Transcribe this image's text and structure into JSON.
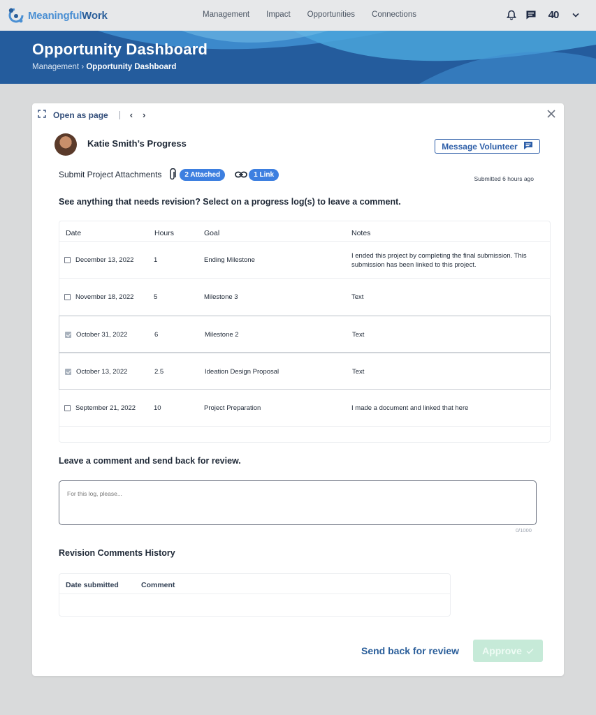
{
  "nav": {
    "logo_part1": "Meaningful",
    "logo_part2": "Work",
    "links": [
      "Management",
      "Impact",
      "Opportunities",
      "Connections"
    ],
    "badge": "40"
  },
  "banner": {
    "title": "Opportunity Dashboard",
    "breadcrumb_parent": "Management",
    "breadcrumb_sep": " › ",
    "breadcrumb_current": "Opportunity Dashboard"
  },
  "card": {
    "open_as_page": "Open as page",
    "progress_title": "Katie Smith’s Progress",
    "message_button": "Message Volunteer",
    "attachments_label": "Submit Project Attachments",
    "attached_pill": "2 Attached",
    "link_pill": "1 Link",
    "submitted": "Submitted 6 hours ago",
    "instruction": "See anything that needs revision? Select on a progress log(s) to leave a comment.",
    "comment_label": "Leave a comment and send back for review.",
    "comment_placeholder": "For this log, please...",
    "counter": "0/1000",
    "history_label": "Revision Comments History",
    "send_back": "Send back for review",
    "approve": "Approve"
  },
  "log_table": {
    "headers": [
      "Date",
      "Hours",
      "Goal",
      "Notes"
    ],
    "rows": [
      {
        "checked": false,
        "date": "December 13, 2022",
        "hours": "1",
        "goal": "Ending Milestone",
        "notes": "I ended this project by completing the final submission. This submission has been linked to this project."
      },
      {
        "checked": false,
        "date": "November 18, 2022",
        "hours": "5",
        "goal": "Milestone 3",
        "notes": "Text"
      },
      {
        "checked": true,
        "date": "October 31, 2022",
        "hours": "6",
        "goal": "Milestone 2",
        "notes": "Text"
      },
      {
        "checked": true,
        "date": "October 13, 2022",
        "hours": "2.5",
        "goal": "Ideation Design Proposal",
        "notes": "Text"
      },
      {
        "checked": false,
        "date": "September 21, 2022",
        "hours": "10",
        "goal": "Project Preparation",
        "notes": "I made a document and linked that here"
      }
    ]
  },
  "history_table": {
    "headers": [
      "Date submitted",
      "Comment"
    ]
  },
  "colors": {
    "brand_blue": "#2a5e9a",
    "banner_blue": "#245c9d",
    "pill_blue": "#3d7fe0",
    "approve_disabled": "#c6ead8"
  }
}
